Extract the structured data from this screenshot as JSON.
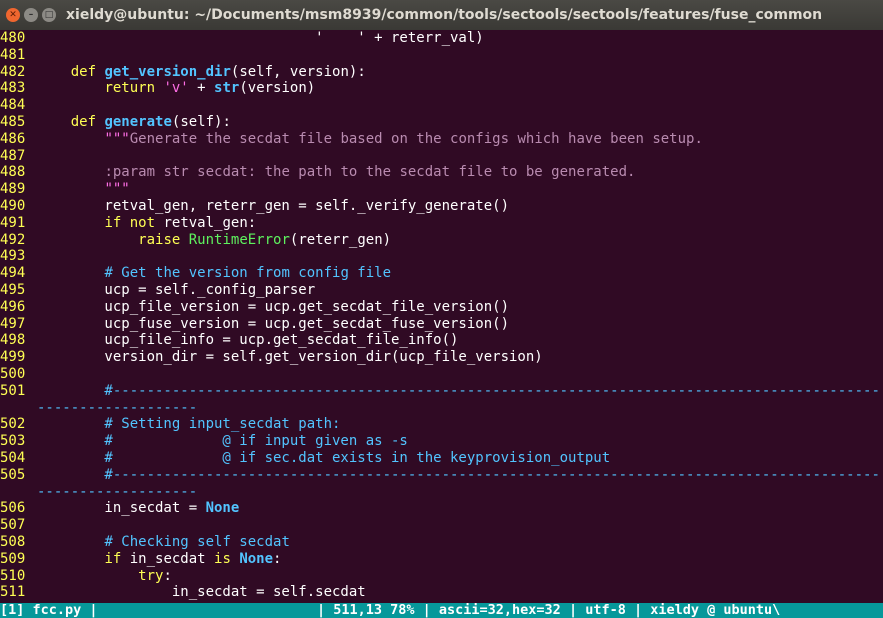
{
  "window": {
    "title": "xieldy@ubuntu: ~/Documents/msm8939/common/tools/sectools/sectools/features/fuse_common",
    "close_glyph": "✕",
    "minimize_glyph": "–",
    "maximize_glyph": "□"
  },
  "code": {
    "l480": {
      "num": "480",
      "a": "                                 '    ' + reterr_val)"
    },
    "l481": {
      "num": "481"
    },
    "l482": {
      "num": "482",
      "indent": "    ",
      "kw": "def",
      "fn": "get_version_dir",
      "rest": "(self, version):"
    },
    "l483": {
      "num": "483",
      "indent": "        ",
      "kw": "return",
      "str": "'v'",
      "mid": " + ",
      "fn": "str",
      "rest": "(version)"
    },
    "l484": {
      "num": "484"
    },
    "l485": {
      "num": "485",
      "indent": "    ",
      "kw": "def",
      "fn": "generate",
      "rest": "(self):"
    },
    "l486": {
      "num": "486",
      "indent": "        ",
      "q": "\"\"\"",
      "doc": "Generate the secdat file based on the configs which have been setup."
    },
    "l487": {
      "num": "487"
    },
    "l488": {
      "num": "488",
      "indent": "        ",
      "doc": ":param str secdat: the path to the secdat file to be generated."
    },
    "l489": {
      "num": "489",
      "indent": "        ",
      "q": "\"\"\""
    },
    "l490": {
      "num": "490",
      "text": "        retval_gen, reterr_gen = self._verify_generate()"
    },
    "l491": {
      "num": "491",
      "indent": "        ",
      "kw1": "if",
      "kw2": "not",
      "rest": " retval_gen:"
    },
    "l492": {
      "num": "492",
      "indent": "            ",
      "kw": "raise",
      "exc": "RuntimeError",
      "rest": "(reterr_gen)"
    },
    "l493": {
      "num": "493"
    },
    "l494": {
      "num": "494",
      "indent": "        ",
      "comment": "# Get the version from config file"
    },
    "l495": {
      "num": "495",
      "text": "        ucp = self._config_parser"
    },
    "l496": {
      "num": "496",
      "text": "        ucp_file_version = ucp.get_secdat_file_version()"
    },
    "l497": {
      "num": "497",
      "text": "        ucp_fuse_version = ucp.get_secdat_fuse_version()"
    },
    "l498": {
      "num": "498",
      "text": "        ucp_file_info = ucp.get_secdat_file_info()"
    },
    "l499": {
      "num": "499",
      "text": "        version_dir = self.get_version_dir(ucp_file_version)"
    },
    "l500": {
      "num": "500"
    },
    "l501": {
      "num": "501",
      "comment": "        #-------------------------------------------------------------------------------------------"
    },
    "l501w": {
      "comment": "-------------------"
    },
    "l502": {
      "num": "502",
      "comment": "        # Setting input_secdat path:"
    },
    "l503": {
      "num": "503",
      "comment": "        #             @ if input given as -s"
    },
    "l504": {
      "num": "504",
      "comment": "        #             @ if sec.dat exists in the keyprovision_output"
    },
    "l505": {
      "num": "505",
      "comment": "        #-------------------------------------------------------------------------------------------"
    },
    "l505w": {
      "comment": "-------------------"
    },
    "l506": {
      "num": "506",
      "text": "        in_secdat = ",
      "const": "None"
    },
    "l507": {
      "num": "507"
    },
    "l508": {
      "num": "508",
      "indent": "        ",
      "comment": "# Checking self secdat"
    },
    "l509": {
      "num": "509",
      "indent": "        ",
      "kw": "if",
      "text": " in_secdat ",
      "kw2": "is",
      "const": "None",
      "rest": ":"
    },
    "l510": {
      "num": "510",
      "indent": "            ",
      "kw": "try",
      "rest": ":"
    },
    "l511": {
      "num": "511",
      "text": "                in_secdat = self.secdat"
    }
  },
  "status": {
    "text": "[1] fcc.py |                           | 511,13 78% | ascii=32,hex=32 | utf-8 | xieldy @ ubuntu\\"
  },
  "colors": {
    "background": "#300a24",
    "line_numbers": "#ffff54",
    "keywords": "#ffff54",
    "functions_comments": "#52c4ff",
    "strings": "#ff6ee6",
    "docstring": "#b98bb0",
    "exception": "#5ef25e",
    "status_bar": "#06989a"
  }
}
